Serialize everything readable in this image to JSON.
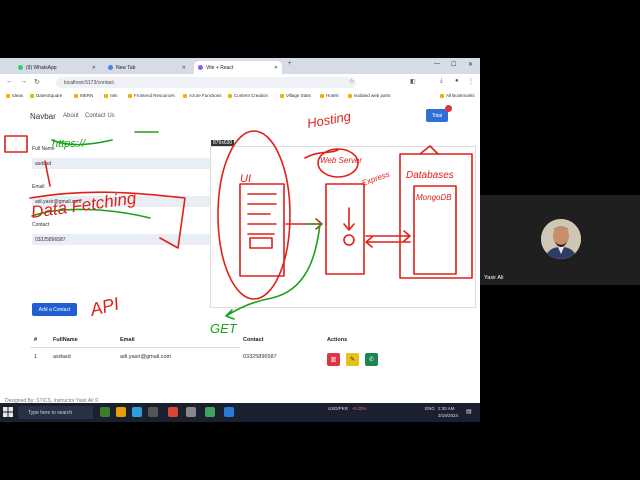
{
  "browser": {
    "tabs": [
      {
        "label": "(9) WhatsApp"
      },
      {
        "label": "New Tab"
      },
      {
        "label": "Vite + React"
      }
    ],
    "url": "localhost:5173/contact",
    "bookmarks": [
      "Ideas",
      "DatesSquare",
      "MERN",
      "n8n",
      "Frontend Resources",
      "Azure Functions",
      "Content Creation",
      "Village Stats",
      "Hotels",
      "Isolated web parts",
      "All Bookmarks"
    ]
  },
  "app": {
    "brand": "Navbar",
    "nav": [
      "About",
      "Contact Us"
    ],
    "total_button": "Total",
    "form": {
      "full_name_label": "Full Name",
      "full_name_value": "asdasd",
      "email_label": "Email",
      "email_value": "adi.yasir@gmail.com",
      "contact_label": "Contact",
      "contact_value": "03325896587",
      "submit": "Add a Contact"
    },
    "table": {
      "headers": [
        "#",
        "FullName",
        "Email",
        "Contact",
        "Actions"
      ],
      "rows": [
        {
          "index": "1",
          "fullname": "asdasd",
          "email": "adi.yasir@gmail.com",
          "contact": "03325896587"
        }
      ]
    },
    "footer": "Designed By: STICS, Instructor Yasir Ali ©"
  },
  "overlay": {
    "snip_size": "879x630",
    "annotations": {
      "https": "https://",
      "data_fetching": "Data Fetching",
      "api": "API",
      "get": "GET",
      "hosting": "Hosting",
      "ui": "UI",
      "web_server": "Web Server",
      "express": "Express",
      "databases": "Databases",
      "mongodb": "MongoDB"
    }
  },
  "taskbar": {
    "search_placeholder": "Type here to search",
    "ticker": "USD/PKR",
    "ticker_change": "-0.23%",
    "lang": "ENG",
    "time": "2:30 AM",
    "date": "3/19/2024"
  },
  "participant": {
    "name": "Yasir Ali"
  },
  "colors": {
    "ink_red": "#e0201a",
    "ink_green": "#1aa11a",
    "primary": "#2f6fd6"
  }
}
